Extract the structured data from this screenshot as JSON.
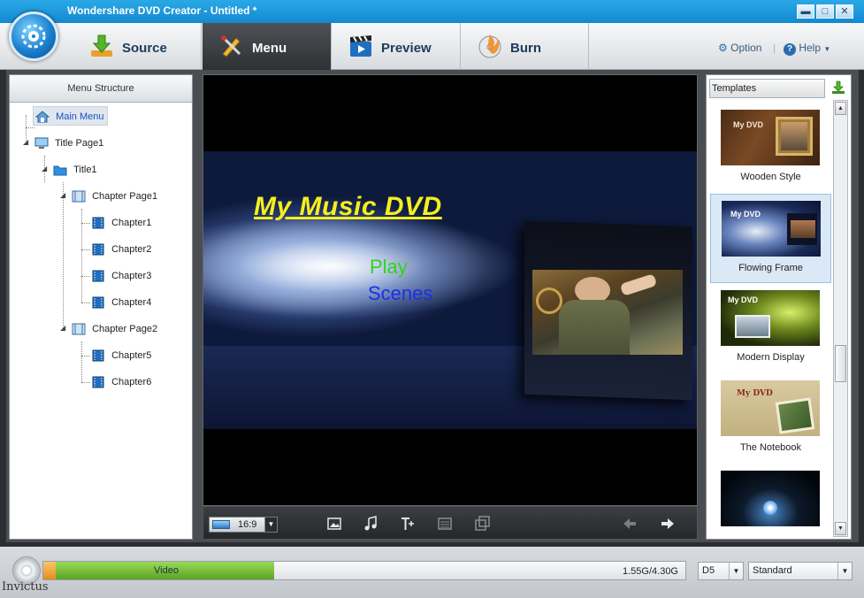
{
  "window": {
    "title": "Wondershare DVD Creator - Untitled *",
    "controls": [
      "minimize",
      "maximize",
      "close"
    ]
  },
  "toolbar": {
    "tabs": [
      {
        "label": "Source",
        "icon": "download-arrow-icon",
        "active": false
      },
      {
        "label": "Menu",
        "icon": "pencil-brush-icon",
        "active": true
      },
      {
        "label": "Preview",
        "icon": "clapperboard-icon",
        "active": false
      },
      {
        "label": "Burn",
        "icon": "disc-fire-icon",
        "active": false
      }
    ],
    "option_label": "Option",
    "help_label": "Help"
  },
  "menu_structure": {
    "title": "Menu Structure",
    "nodes": [
      {
        "label": "Main Menu",
        "icon": "home-icon",
        "selected": true
      },
      {
        "label": "Title Page1",
        "icon": "monitor-icon"
      },
      {
        "label": "Title1",
        "icon": "folder-icon"
      },
      {
        "label": "Chapter Page1",
        "icon": "film-page-icon"
      },
      {
        "label": "Chapter1",
        "icon": "film-icon"
      },
      {
        "label": "Chapter2",
        "icon": "film-icon"
      },
      {
        "label": "Chapter3",
        "icon": "film-icon"
      },
      {
        "label": "Chapter4",
        "icon": "film-icon"
      },
      {
        "label": "Chapter Page2",
        "icon": "film-page-icon"
      },
      {
        "label": "Chapter5",
        "icon": "film-icon"
      },
      {
        "label": "Chapter6",
        "icon": "film-icon"
      }
    ]
  },
  "preview": {
    "dvd_title": "My Music DVD",
    "play_label": "Play",
    "scenes_label": "Scenes",
    "title_color": "#f5ef1f",
    "play_color": "#2fd31a",
    "scenes_color": "#1c2ee8"
  },
  "controls": {
    "aspect_ratio": "16:9",
    "icons": [
      "background-image-icon",
      "music-note-icon",
      "add-text-icon",
      "chapter-list-icon",
      "frame-settings-icon",
      "arrow-left-icon",
      "arrow-right-icon"
    ]
  },
  "templates": {
    "title": "Templates",
    "items": [
      {
        "name": "Wooden Style",
        "thumb_text": "My DVD"
      },
      {
        "name": "Flowing Frame",
        "thumb_text": "My DVD",
        "selected": true
      },
      {
        "name": "Modern Display",
        "thumb_text": "My DVD"
      },
      {
        "name": "The Notebook",
        "thumb_text": "My DVD"
      },
      {
        "name": "",
        "thumb_text": ""
      }
    ]
  },
  "status": {
    "progress_label": "Video",
    "progress_fraction": 0.36,
    "size": "1.55G/4.30G",
    "disc_type": "D5",
    "quality": "Standard"
  },
  "watermark": "Invictus",
  "colors": {
    "titlebar": "#1a95da",
    "active_tab": "#3c4044",
    "progress_fill": "#6bb62f",
    "selection_link": "#1a4fc6"
  }
}
